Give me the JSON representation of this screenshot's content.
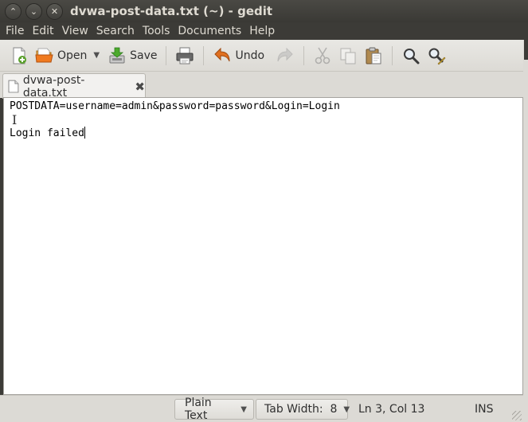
{
  "window": {
    "title": "dvwa-post-data.txt (~) - gedit",
    "controls": [
      "⌃",
      "⌄",
      "✕"
    ]
  },
  "menubar": [
    "File",
    "Edit",
    "View",
    "Search",
    "Tools",
    "Documents",
    "Help"
  ],
  "toolbar": {
    "open_label": "Open",
    "save_label": "Save",
    "undo_label": "Undo"
  },
  "tab": {
    "label": "dvwa-post-data.txt",
    "close": "✖"
  },
  "document": {
    "lines": [
      "POSTDATA=username=admin&password=password&Login=Login",
      "",
      "Login failed"
    ]
  },
  "statusbar": {
    "language": "Plain Text",
    "tab_width": "Tab Width:  8",
    "position": "Ln 3, Col 13",
    "mode": "INS"
  },
  "colors": {
    "titlebar": "#3c3b37",
    "toolbar": "#dcdad5",
    "editor_bg": "#ffffff",
    "undo_accent": "#e07020"
  }
}
